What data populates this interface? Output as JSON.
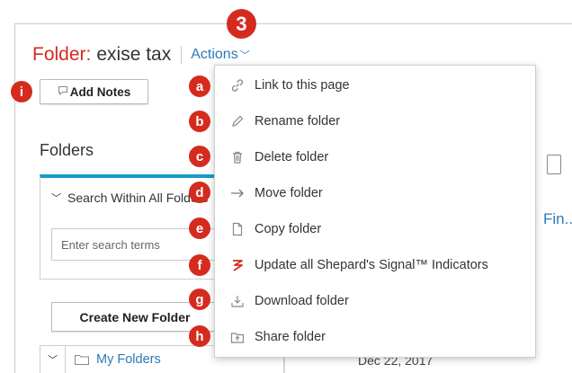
{
  "header": {
    "folder_prefix": "Folder:",
    "folder_name": "exise tax",
    "actions_label": "Actions",
    "actions_badge": "3"
  },
  "toolbar": {
    "add_notes_label": "Add Notes",
    "add_notes_badge": "i"
  },
  "sidebar": {
    "title": "Folders",
    "search_heading": "Search Within All Folders",
    "search_placeholder": "Enter search terms",
    "create_button": "Create New Folder",
    "tree_item": "My Folders"
  },
  "content": {
    "link_text": "Fin...",
    "date": "Dec 22, 2017"
  },
  "actions_menu": {
    "items": [
      {
        "badge": "a",
        "label": "Link to this page",
        "icon": "link-icon"
      },
      {
        "badge": "b",
        "label": "Rename folder",
        "icon": "pencil-icon"
      },
      {
        "badge": "c",
        "label": "Delete folder",
        "icon": "trash-icon"
      },
      {
        "badge": "d",
        "label": "Move folder",
        "icon": "arrow-right-icon"
      },
      {
        "badge": "e",
        "label": "Copy folder",
        "icon": "copy-icon"
      },
      {
        "badge": "f",
        "label": "Update all Shepard's Signal™ Indicators",
        "icon": "signal-icon"
      },
      {
        "badge": "g",
        "label": "Download folder",
        "icon": "download-icon"
      },
      {
        "badge": "h",
        "label": "Share folder",
        "icon": "share-icon"
      }
    ]
  },
  "colors": {
    "accent_red": "#d52b1e",
    "link_blue": "#2a7ab8",
    "panel_blue": "#1a99c9"
  }
}
